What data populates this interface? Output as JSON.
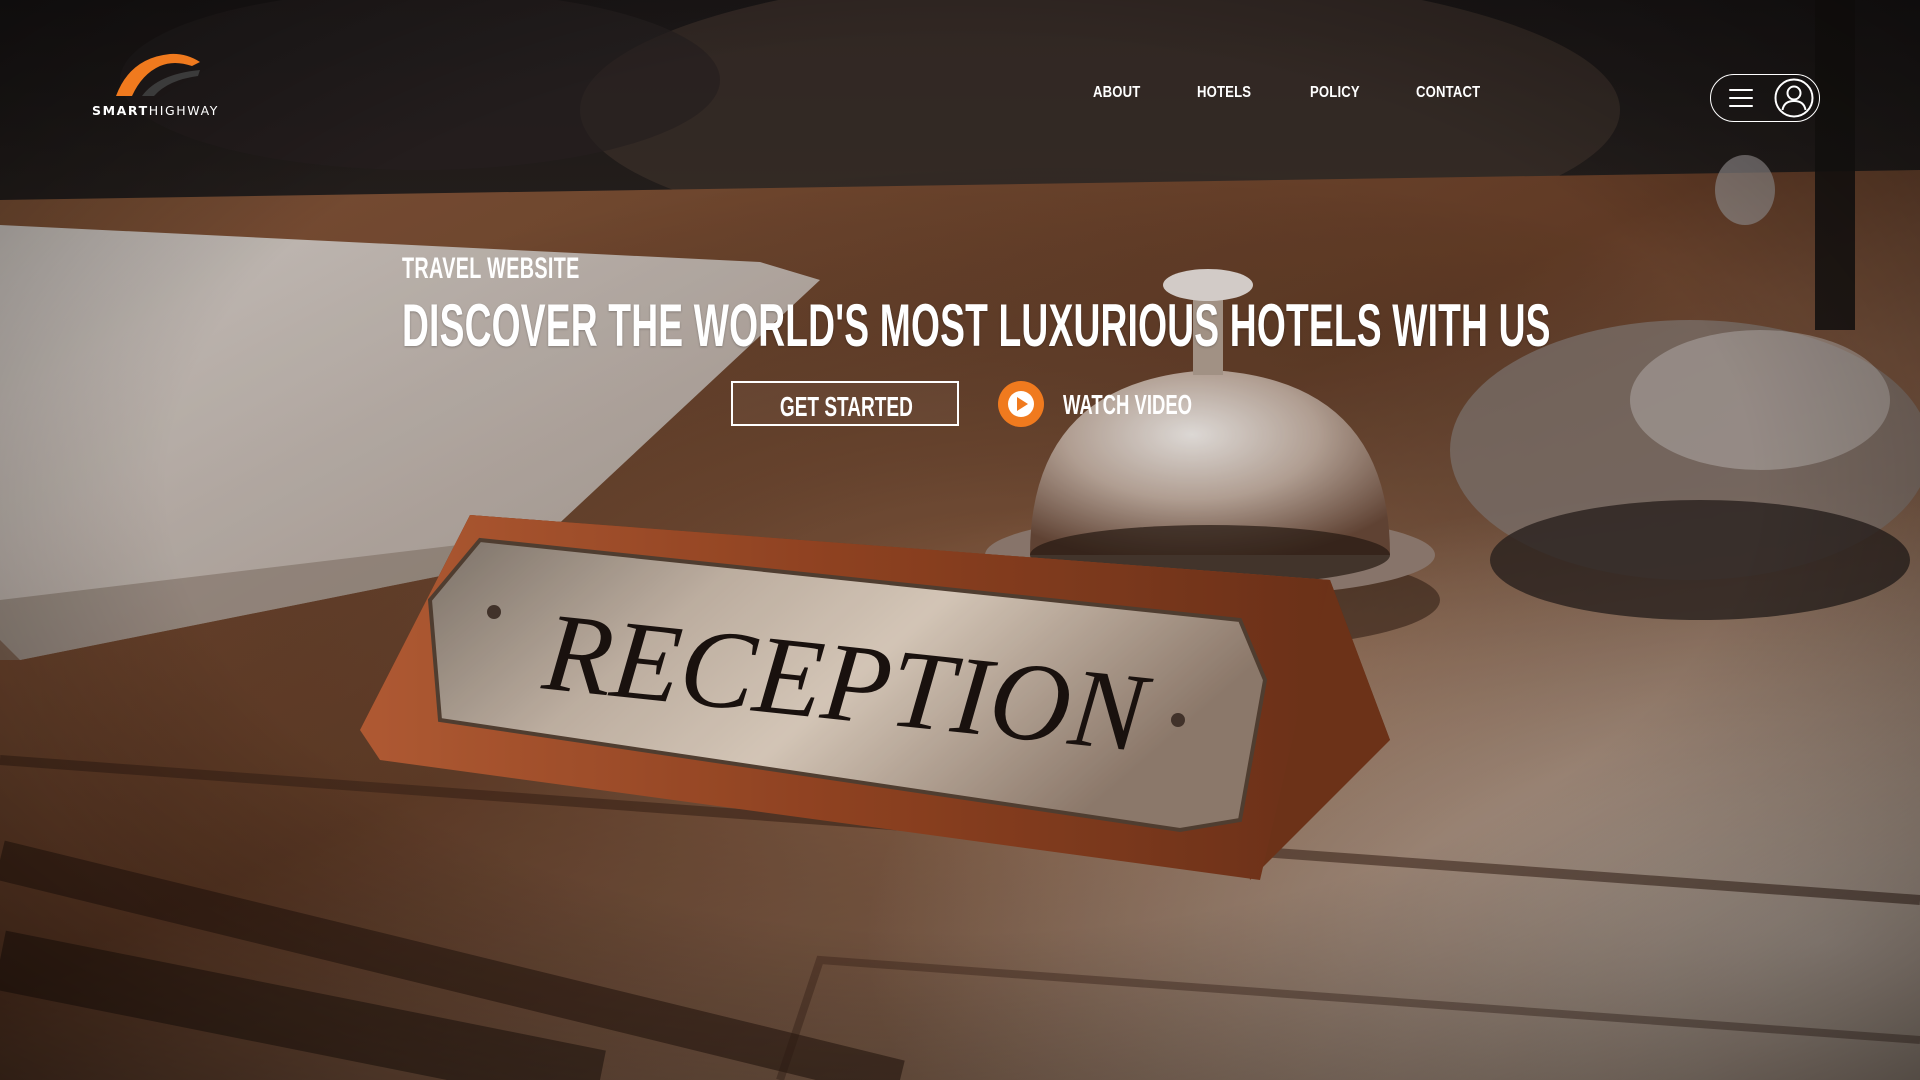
{
  "brand": {
    "name_bold": "SMART",
    "name_light": "HIGHWAY",
    "accent_color": "#F07A1E"
  },
  "nav": {
    "items": [
      {
        "label": "ABOUT"
      },
      {
        "label": "HOTELS"
      },
      {
        "label": "POLICY"
      },
      {
        "label": "CONTACT"
      }
    ]
  },
  "header_actions": {
    "menu_icon": "hamburger-icon",
    "user_icon": "user-avatar-icon"
  },
  "hero": {
    "kicker": "TRAVEL WEBSITE",
    "title": "DISCOVER THE WORLD'S MOST LUXURIOUS HOTELS WITH US",
    "primary_button": "GET STARTED",
    "video_button": "WATCH VIDEO",
    "video_icon": "play-icon"
  },
  "background": {
    "sign_text": "RECEPTION",
    "description_icon": "reception-desk-photo"
  }
}
